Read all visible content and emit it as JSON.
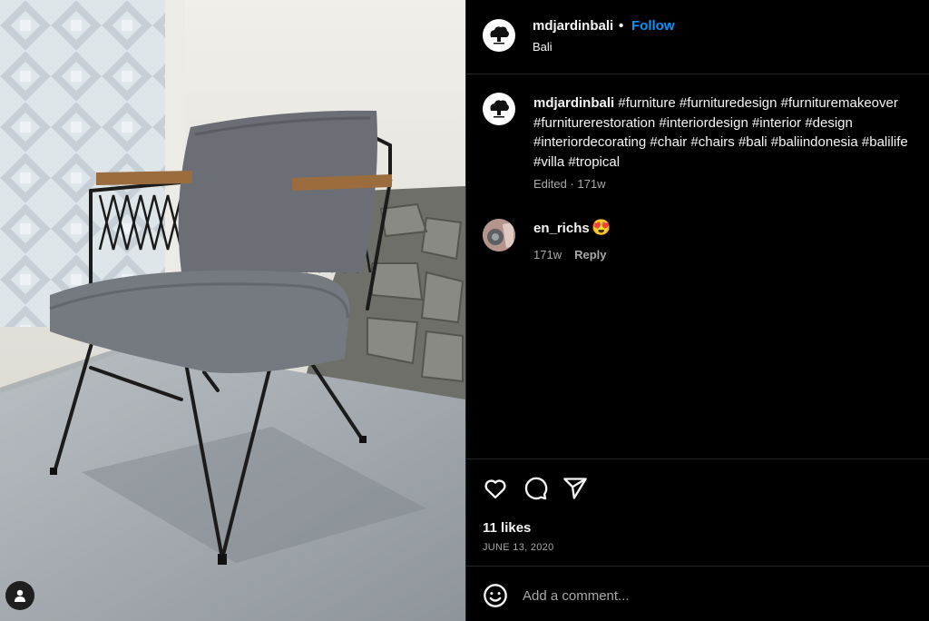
{
  "post": {
    "username": "mdjardinbali",
    "follow_label": "Follow",
    "separator": "•",
    "location": "Bali",
    "avatar_icon": "tree-logo-icon"
  },
  "caption": {
    "username": "mdjardinbali",
    "text": "#furniture #furnituredesign #furnituremakeover #furniturerestoration #interiordesign #interior #design #interiordecorating #chair #chairs #bali #baliindonesia #balilife #villa #tropical",
    "meta": "Edited · 171w"
  },
  "comment": {
    "username": "en_richs",
    "emoji": "😍",
    "age": "171w",
    "reply_label": "Reply"
  },
  "actions": {
    "like_icon": "heart-icon",
    "comment_icon": "comment-icon",
    "share_icon": "share-icon",
    "likes": "11 likes",
    "date": "JUNE 13, 2020"
  },
  "composer": {
    "placeholder": "Add a comment...",
    "emoji_icon": "smiley-icon"
  },
  "colors": {
    "background": "#000000",
    "text": "#f5f5f5",
    "muted": "#a8a8a8",
    "link": "#0095f6",
    "divider": "#262626"
  }
}
